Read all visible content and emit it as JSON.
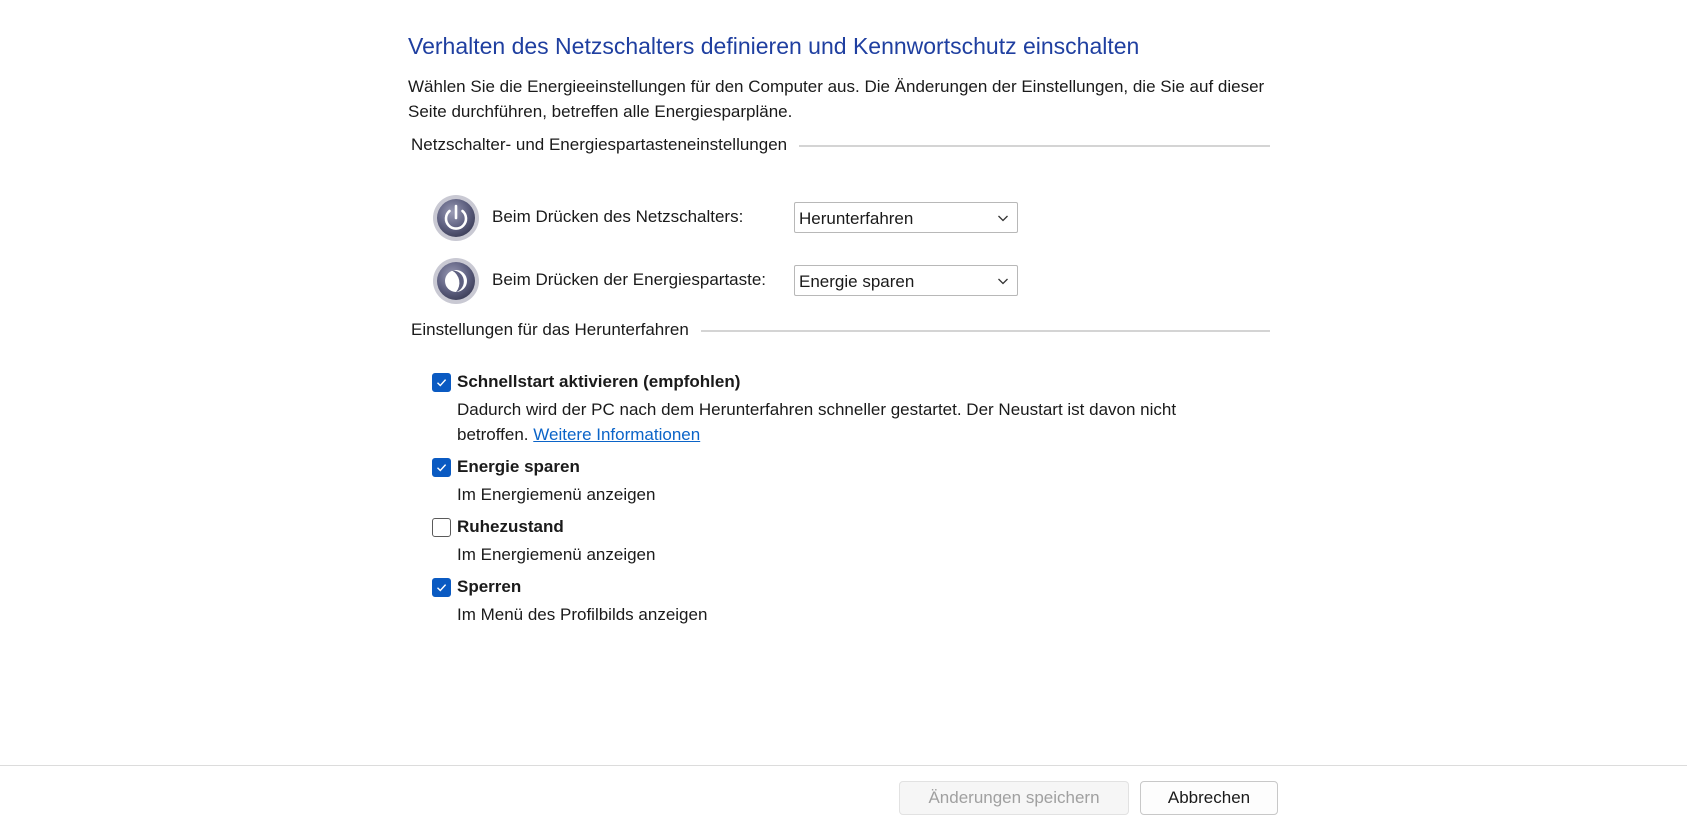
{
  "page": {
    "title": "Verhalten des Netzschalters definieren und Kennwortschutz einschalten",
    "description": "Wählen Sie die Energieeinstellungen für den Computer aus. Die Änderungen der Einstellungen, die Sie auf dieser Seite durchführen, betreffen alle Energiesparpläne."
  },
  "buttons_section": {
    "header": "Netzschalter- und Energiespartasteneinstellungen",
    "rows": [
      {
        "icon": "power-icon",
        "label": "Beim Drücken des Netzschalters:",
        "selected": "Herunterfahren"
      },
      {
        "icon": "sleep-icon",
        "label": "Beim Drücken der Energiespartaste:",
        "selected": "Energie sparen"
      }
    ]
  },
  "shutdown_section": {
    "header": "Einstellungen für das Herunterfahren",
    "options": [
      {
        "title": "Schnellstart aktivieren (empfohlen)",
        "checked": true,
        "description": "Dadurch wird der PC nach dem Herunterfahren schneller gestartet. Der Neustart ist davon nicht betroffen.",
        "link": "Weitere Informationen"
      },
      {
        "title": "Energie sparen",
        "checked": true,
        "description": "Im Energiemenü anzeigen"
      },
      {
        "title": "Ruhezustand",
        "checked": false,
        "description": "Im Energiemenü anzeigen"
      },
      {
        "title": "Sperren",
        "checked": true,
        "description": "Im Menü des Profilbilds anzeigen"
      }
    ]
  },
  "footer": {
    "save_label": "Änderungen speichern",
    "cancel_label": "Abbrechen"
  },
  "colors": {
    "title": "#1f3fa0",
    "checkbox_checked": "#0a5ac2",
    "link": "#0b64c8"
  }
}
